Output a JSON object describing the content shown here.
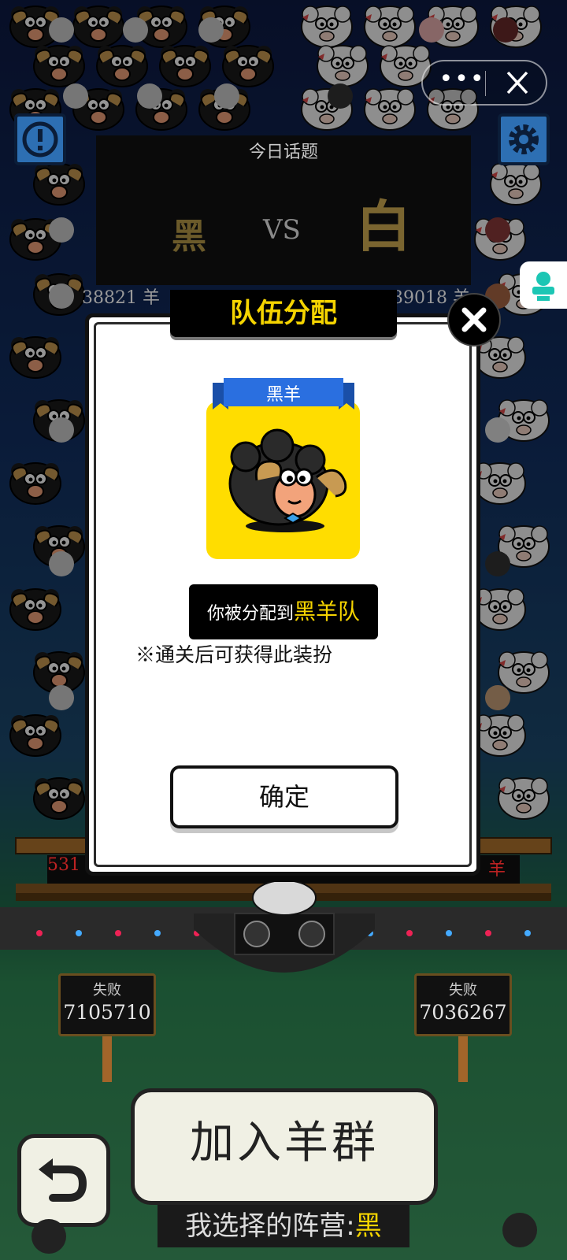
{
  "topic": {
    "header": "今日话题",
    "black": "黑",
    "vs": "VS",
    "white": "白",
    "black_count": "38821 羊",
    "white_count": "39018 羊"
  },
  "modal": {
    "title": "队伍分配",
    "ribbon_label": "黑羊",
    "assign_prefix": "你被分配到",
    "assign_team": "黑羊队",
    "note": "※通关后可获得此装扮",
    "confirm_label": "确定"
  },
  "stage": {
    "left_rail_number": "531",
    "right_rail_text": "羊"
  },
  "scores": {
    "left": {
      "label": "失败",
      "value": "7105710"
    },
    "right": {
      "label": "失败",
      "value": "7036267"
    }
  },
  "join_button_label": "加入羊群",
  "camp": {
    "prefix": "我选择的阵营:",
    "value": "黑"
  },
  "capsule": {
    "more": "•••"
  },
  "colors": {
    "accent_yellow": "#f5d400",
    "sky_top": "#0d1a44",
    "grass": "#3f9a62",
    "info_blue": "#2d6fb3"
  },
  "icons": [
    "info-icon",
    "gear-icon",
    "more-dots-icon",
    "close-icon",
    "mini-program-icon",
    "undo-icon",
    "black-sheep-avatar-icon"
  ]
}
